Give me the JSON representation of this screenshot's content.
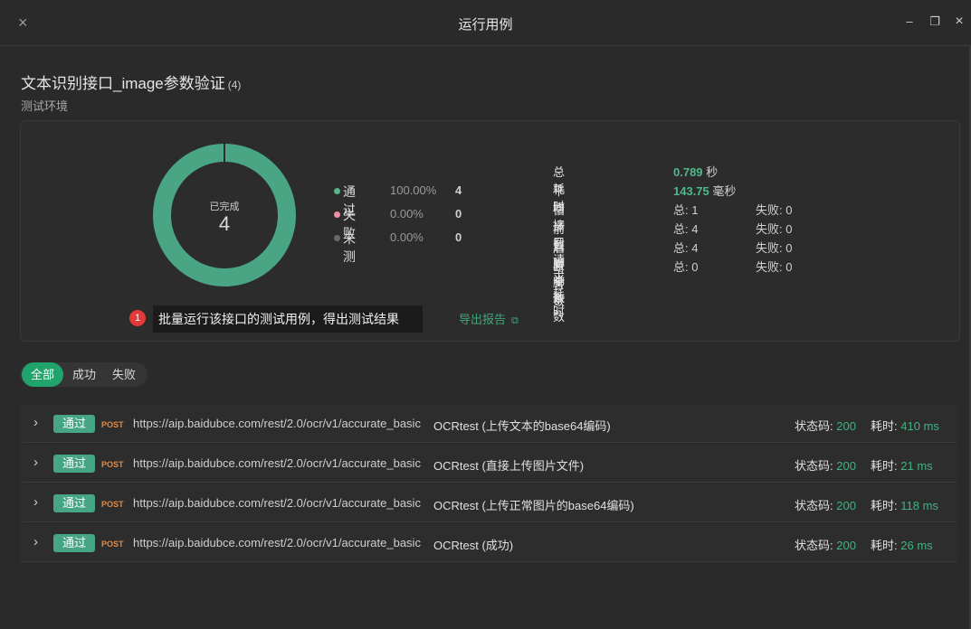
{
  "window": {
    "title": "运行用例",
    "close_icon": "close-icon",
    "min_icon": "minimize-icon",
    "max_icon": "maximize-icon"
  },
  "suite": {
    "title": "文本识别接口_image参数验证",
    "count": "(4)",
    "env": "测试环境"
  },
  "donut": {
    "label": "已完成",
    "value": "4",
    "passed_fraction": 1.0,
    "color_pass": "#49a583"
  },
  "legend": [
    {
      "name": "通过",
      "pct": "100.00%",
      "num": "4",
      "color": "#4fb98a"
    },
    {
      "name": "失败",
      "pct": "0.00%",
      "num": "0",
      "color": "#f08fa3"
    },
    {
      "name": "未测",
      "pct": "0.00%",
      "num": "0",
      "color": "#6a6a6a"
    }
  ],
  "stats": {
    "total_time": {
      "label": "总耗时",
      "value": "0.789",
      "unit": "秒"
    },
    "avg_time": {
      "label": "平均接口请求耗时",
      "value": "143.75",
      "unit": "毫秒"
    },
    "rows": [
      {
        "label": "循环数",
        "v1": "总: 1",
        "v2": "失败: 0"
      },
      {
        "label": "前置脚本数",
        "v1": "总: 4",
        "v2": "失败: 0"
      },
      {
        "label": "后置脚本数",
        "v1": "总: 4",
        "v2": "失败: 0"
      },
      {
        "label": "断言数",
        "v1": "总: 0",
        "v2": "失败: 0"
      }
    ]
  },
  "tooltip": {
    "badge": "1",
    "text": "批量运行该接口的测试用例，得出测试结果"
  },
  "export": {
    "label": "导出报告",
    "icon": "external-link-icon"
  },
  "filters": {
    "all": "全部",
    "success": "成功",
    "fail": "失败"
  },
  "results": [
    {
      "status_badge": "通过",
      "method": "POST",
      "url": "https://aip.baidubce.com/rest/2.0/ocr/v1/accurate_basic",
      "case": "OCRtest (上传文本的base64编码)",
      "status_label": "状态码:",
      "status_code": "200",
      "time_label": "耗时:",
      "time": "410 ms"
    },
    {
      "status_badge": "通过",
      "method": "POST",
      "url": "https://aip.baidubce.com/rest/2.0/ocr/v1/accurate_basic",
      "case": "OCRtest (直接上传图片文件)",
      "status_label": "状态码:",
      "status_code": "200",
      "time_label": "耗时:",
      "time": "21 ms"
    },
    {
      "status_badge": "通过",
      "method": "POST",
      "url": "https://aip.baidubce.com/rest/2.0/ocr/v1/accurate_basic",
      "case": "OCRtest (上传正常图片的base64编码)",
      "status_label": "状态码:",
      "status_code": "200",
      "time_label": "耗时:",
      "time": "118 ms"
    },
    {
      "status_badge": "通过",
      "method": "POST",
      "url": "https://aip.baidubce.com/rest/2.0/ocr/v1/accurate_basic",
      "case": "OCRtest (成功)",
      "status_label": "状态码:",
      "status_code": "200",
      "time_label": "耗时:",
      "time": "26 ms"
    }
  ]
}
